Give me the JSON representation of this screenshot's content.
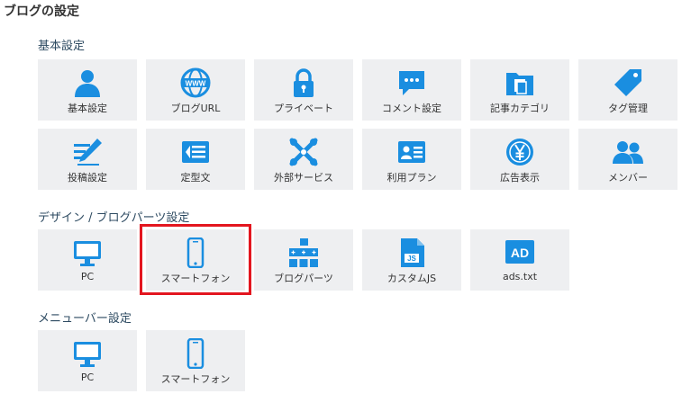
{
  "page_title": "ブログの設定",
  "sections": {
    "basic": {
      "title": "基本設定",
      "items": [
        {
          "label": "基本設定",
          "icon": "user-icon"
        },
        {
          "label": "ブログURL",
          "icon": "www-globe-icon"
        },
        {
          "label": "プライベート",
          "icon": "lock-icon"
        },
        {
          "label": "コメント設定",
          "icon": "comment-icon"
        },
        {
          "label": "記事カテゴリ",
          "icon": "folder-icon"
        },
        {
          "label": "タグ管理",
          "icon": "tag-icon"
        },
        {
          "label": "投稿設定",
          "icon": "pencil-icon"
        },
        {
          "label": "定型文",
          "icon": "template-icon"
        },
        {
          "label": "外部サービス",
          "icon": "external-service-icon"
        },
        {
          "label": "利用プラン",
          "icon": "plan-card-icon"
        },
        {
          "label": "広告表示",
          "icon": "yen-coin-icon"
        },
        {
          "label": "メンバー",
          "icon": "members-icon"
        }
      ]
    },
    "design": {
      "title": "デザイン / ブログパーツ設定",
      "items": [
        {
          "label": "PC",
          "icon": "monitor-icon"
        },
        {
          "label": "スマートフォン",
          "icon": "smartphone-icon"
        },
        {
          "label": "ブログパーツ",
          "icon": "blog-parts-icon"
        },
        {
          "label": "カスタムJS",
          "icon": "js-file-icon"
        },
        {
          "label": "ads.txt",
          "icon": "ad-icon",
          "badge": "AD"
        }
      ]
    },
    "menubar": {
      "title": "メニューバー設定",
      "items": [
        {
          "label": "PC",
          "icon": "monitor-icon"
        },
        {
          "label": "スマートフォン",
          "icon": "smartphone-icon"
        }
      ]
    }
  },
  "colors": {
    "icon": "#1a8ee0",
    "tile_bg": "#eeeff1",
    "highlight": "#e3161f",
    "section_title": "#2d4a61"
  }
}
